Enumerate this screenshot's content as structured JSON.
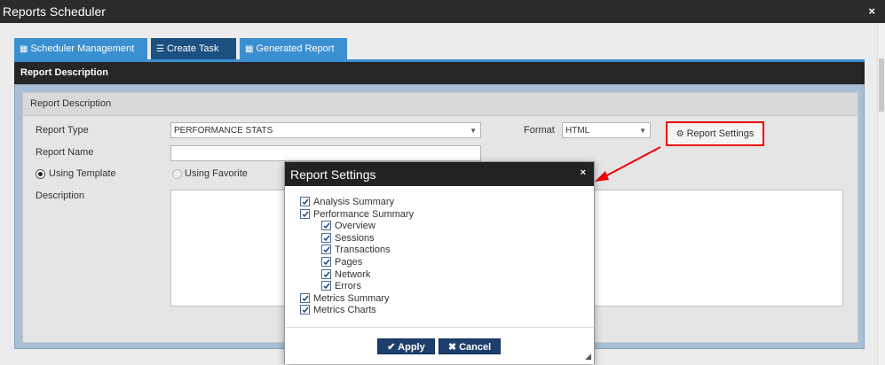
{
  "window": {
    "title": "Reports Scheduler",
    "close": "×"
  },
  "tabs": [
    {
      "label": "Scheduler Management",
      "icon": "calendar-icon"
    },
    {
      "label": "Create Task",
      "icon": "list-icon"
    },
    {
      "label": "Generated Report",
      "icon": "calendar-icon"
    }
  ],
  "panel": {
    "header": "Report Description",
    "section_title": "Report Description"
  },
  "form": {
    "report_type_label": "Report Type",
    "report_type_value": "PERFORMANCE STATS",
    "format_label": "Format",
    "format_value": "HTML",
    "report_settings_button": "Report Settings",
    "report_name_label": "Report Name",
    "report_name_value": "",
    "using_template_label": "Using Template",
    "using_favorite_label": "Using Favorite",
    "description_label": "Description"
  },
  "dialog": {
    "title": "Report Settings",
    "close": "×",
    "items": [
      {
        "label": "Analysis Summary",
        "checked": true
      },
      {
        "label": "Performance Summary",
        "checked": true
      },
      {
        "label": "Overview",
        "checked": true
      },
      {
        "label": "Sessions",
        "checked": true
      },
      {
        "label": "Transactions",
        "checked": true
      },
      {
        "label": "Pages",
        "checked": true
      },
      {
        "label": "Network",
        "checked": true
      },
      {
        "label": "Errors",
        "checked": true
      },
      {
        "label": "Metrics Summary",
        "checked": true
      },
      {
        "label": "Metrics Charts",
        "checked": true
      }
    ],
    "apply_label": "Apply",
    "cancel_label": "Cancel"
  },
  "colors": {
    "accent": "#3a8fd0",
    "active_tab": "#1c5080",
    "highlight": "#e00000",
    "button": "#1c3f6e"
  }
}
